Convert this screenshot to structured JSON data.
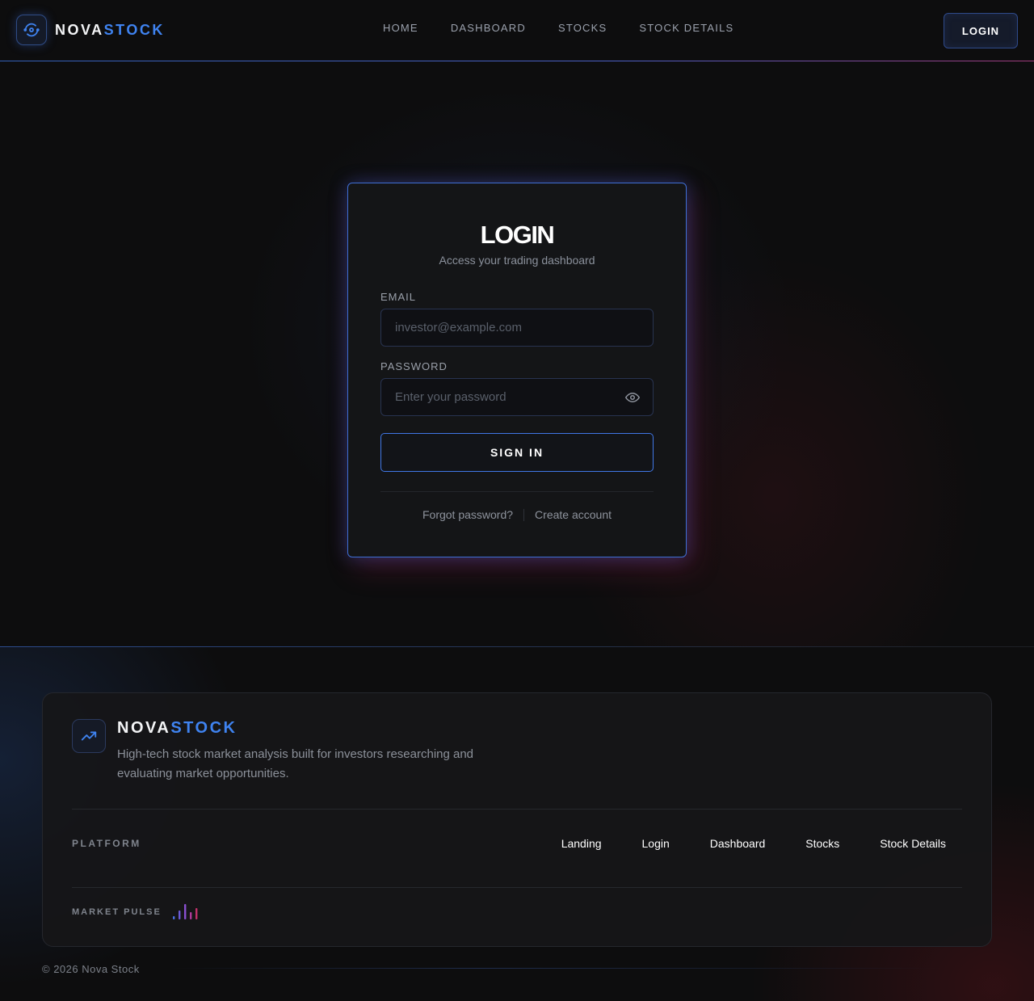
{
  "header": {
    "brand_part1": "NOVA",
    "brand_part2": "STOCK",
    "nav": [
      "HOME",
      "DASHBOARD",
      "STOCKS",
      "STOCK DETAILS"
    ],
    "login_label": "LOGIN"
  },
  "login_card": {
    "title": "LOGIN",
    "subtitle": "Access your trading dashboard",
    "email_label": "EMAIL",
    "email_placeholder": "investor@example.com",
    "password_label": "PASSWORD",
    "password_placeholder": "Enter your password",
    "signin_label": "SIGN IN",
    "forgot_label": "Forgot password?",
    "create_label": "Create account"
  },
  "footer": {
    "brand_part1": "NOVA",
    "brand_part2": "STOCK",
    "description": "High-tech stock market analysis built for investors researching and evaluating market opportunities.",
    "platform_label": "PLATFORM",
    "platform_links": [
      "Landing",
      "Login",
      "Dashboard",
      "Stocks",
      "Stock Details"
    ],
    "pulse_label": "MARKET PULSE",
    "copyright": "© 2026 Nova Stock"
  },
  "colors": {
    "accent_blue": "#3f83f0",
    "accent_red": "#c0306a",
    "background": "#0d0d0e"
  },
  "icons": {
    "brand": "refresh-eye-icon",
    "password_toggle": "eye-icon",
    "footer_brand": "trending-up-icon",
    "pulse": "bar-chart-icon"
  }
}
